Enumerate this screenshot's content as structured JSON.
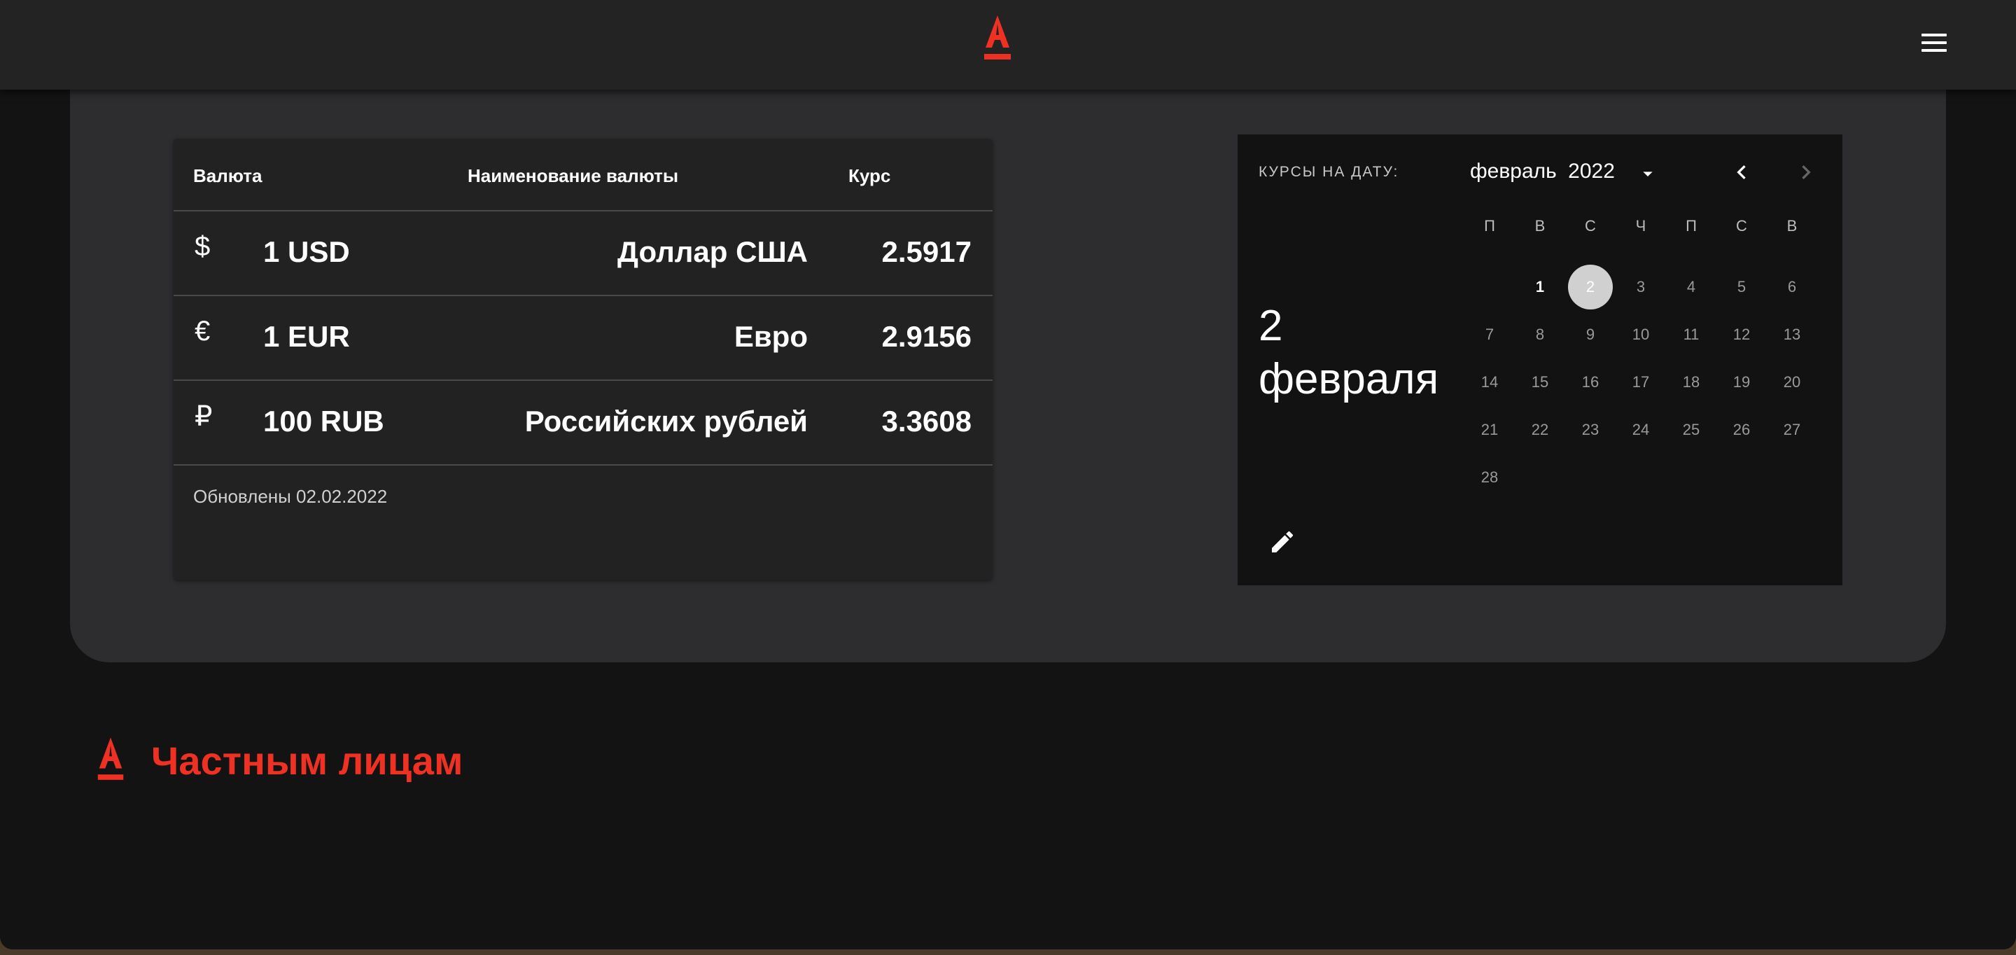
{
  "colors": {
    "brand_red": "#ef3124",
    "bg": "#131313",
    "panel": "#2d2d2f",
    "card": "#222222"
  },
  "header": {
    "logo": "alfa-bank-logo",
    "menu_icon": "hamburger-menu-icon"
  },
  "rates_table": {
    "columns": [
      "Валюта",
      "Наименование валюты",
      "Курс"
    ],
    "rows": [
      {
        "icon": "$",
        "amount": "1 USD",
        "name": "Доллар США",
        "rate": "2.5917"
      },
      {
        "icon": "€",
        "amount": "1 EUR",
        "name": "Евро",
        "rate": "2.9156"
      },
      {
        "icon": "₽",
        "amount": "100 RUB",
        "name": "Российских рублей",
        "rate": "3.3608"
      }
    ],
    "updated": "Обновлены 02.02.2022"
  },
  "calendar": {
    "caption": "КУРСЫ НА ДАТУ:",
    "big_date": "2 февраля",
    "month": "февраль",
    "year": "2022",
    "weekdays": [
      "П",
      "В",
      "С",
      "Ч",
      "П",
      "С",
      "В"
    ],
    "days": [
      "1",
      "2",
      "3",
      "4",
      "5",
      "6",
      "7",
      "8",
      "9",
      "10",
      "11",
      "12",
      "13",
      "14",
      "15",
      "16",
      "17",
      "18",
      "19",
      "20",
      "21",
      "22",
      "23",
      "24",
      "25",
      "26",
      "27",
      "28"
    ],
    "selected_day": "2",
    "active_day": "1"
  },
  "footer": {
    "title": "Частным лицам"
  }
}
